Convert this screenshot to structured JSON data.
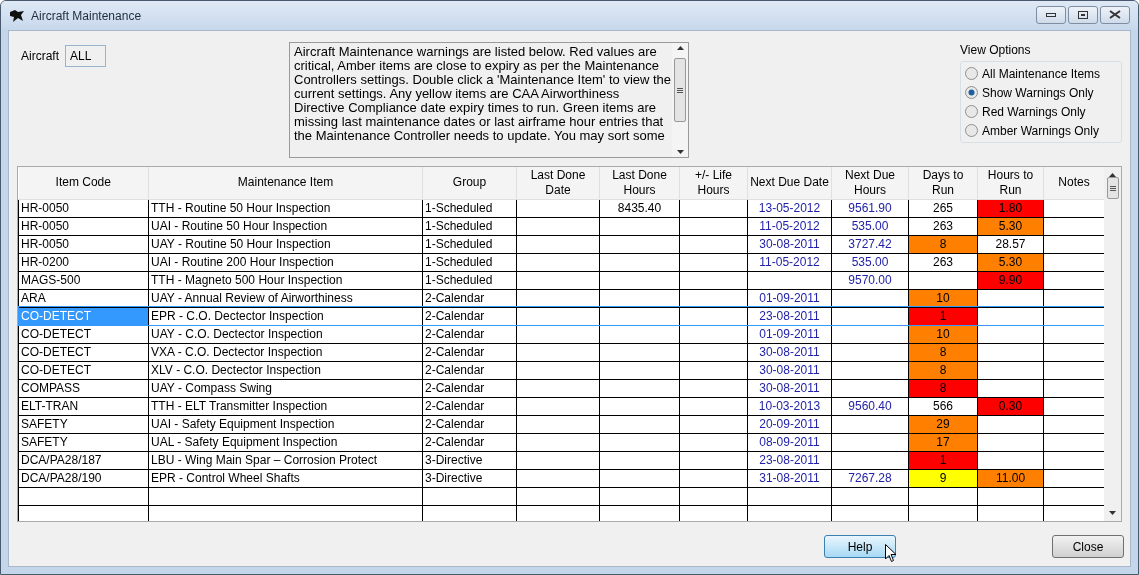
{
  "window": {
    "title": "Aircraft Maintenance"
  },
  "aircraft": {
    "label": "Aircraft",
    "value": "ALL"
  },
  "description": "Aircraft Maintenance warnings are listed below. Red values are critical, Amber items are close to expiry as per the Maintenance Controllers settings. Double click a 'Maintenance Item' to view the current settings. Any yellow items are CAA Airworthiness Directive Compliance date expiry times to run. Green items are missing last maintenance dates or last airframe hour entries that the Maintenance Controller needs to update. You may sort some",
  "view_options": {
    "title": "View Options",
    "options": [
      {
        "label": "All Maintenance Items",
        "selected": false
      },
      {
        "label": "Show Warnings Only",
        "selected": true
      },
      {
        "label": "Red Warnings Only",
        "selected": false
      },
      {
        "label": "Amber Warnings Only",
        "selected": false
      }
    ]
  },
  "table": {
    "columns": [
      "Item Code",
      "Maintenance Item",
      "Group",
      "Last Done Date",
      "Last Done Hours",
      "+/- Life Hours",
      "Next Due Date",
      "Next Due Hours",
      "Days to Run",
      "Hours to Run",
      "Notes"
    ],
    "rows": [
      {
        "item_code": "HR-0050",
        "maintenance_item": "TTH - Routine 50 Hour Inspection",
        "group": "1-Scheduled",
        "last_done_hours": "8435.40",
        "next_due_date": "13-05-2012",
        "next_due_hours": "9561.90",
        "days_to_run": {
          "text": "265"
        },
        "hours_to_run": {
          "text": "1.80",
          "color": "#ff0000"
        },
        "selected": false
      },
      {
        "item_code": "HR-0050",
        "maintenance_item": "UAI - Routine 50 Hour Inspection",
        "group": "1-Scheduled",
        "next_due_date": "11-05-2012",
        "next_due_hours": "535.00",
        "days_to_run": {
          "text": "263"
        },
        "hours_to_run": {
          "text": "5.30",
          "color": "#ff8000"
        },
        "selected": false
      },
      {
        "item_code": "HR-0050",
        "maintenance_item": "UAY - Routine 50 Hour Inspection",
        "group": "1-Scheduled",
        "next_due_date": "30-08-2011",
        "next_due_hours": "3727.42",
        "days_to_run": {
          "text": "8",
          "color": "#ff8000"
        },
        "hours_to_run": {
          "text": "28.57"
        },
        "selected": false
      },
      {
        "item_code": "HR-0200",
        "maintenance_item": "UAI - Routine 200 Hour Inspection",
        "group": "1-Scheduled",
        "next_due_date": "11-05-2012",
        "next_due_hours": "535.00",
        "days_to_run": {
          "text": "263"
        },
        "hours_to_run": {
          "text": "5.30",
          "color": "#ff8000"
        },
        "selected": false
      },
      {
        "item_code": "MAGS-500",
        "maintenance_item": "TTH - Magneto 500 Hour Inspection",
        "group": "1-Scheduled",
        "next_due_hours": "9570.00",
        "hours_to_run": {
          "text": "9.90",
          "color": "#ff0000"
        },
        "selected": false
      },
      {
        "item_code": "ARA",
        "maintenance_item": "UAY - Annual Review of Airworthiness",
        "group": "2-Calendar",
        "next_due_date": "01-09-2011",
        "days_to_run": {
          "text": "10",
          "color": "#ff8000"
        },
        "selected": false
      },
      {
        "item_code": "CO-DETECT",
        "maintenance_item": "EPR - C.O. Dectector Inspection",
        "group": "2-Calendar",
        "next_due_date": "23-08-2011",
        "days_to_run": {
          "text": "1",
          "color": "#ff0000"
        },
        "selected": true
      },
      {
        "item_code": "CO-DETECT",
        "maintenance_item": "UAY - C.O. Dectector Inspection",
        "group": "2-Calendar",
        "next_due_date": "01-09-2011",
        "days_to_run": {
          "text": "10",
          "color": "#ff8000"
        },
        "selected": false
      },
      {
        "item_code": "CO-DETECT",
        "maintenance_item": "VXA - C.O. Dectector Inspection",
        "group": "2-Calendar",
        "next_due_date": "30-08-2011",
        "days_to_run": {
          "text": "8",
          "color": "#ff8000"
        },
        "selected": false
      },
      {
        "item_code": "CO-DETECT",
        "maintenance_item": "XLV - C.O. Dectector Inspection",
        "group": "2-Calendar",
        "next_due_date": "30-08-2011",
        "days_to_run": {
          "text": "8",
          "color": "#ff8000"
        },
        "selected": false
      },
      {
        "item_code": "COMPASS",
        "maintenance_item": "UAY - Compass Swing",
        "group": "2-Calendar",
        "next_due_date": "30-08-2011",
        "days_to_run": {
          "text": "8",
          "color": "#ff0000"
        },
        "selected": false
      },
      {
        "item_code": "ELT-TRAN",
        "maintenance_item": "TTH - ELT Transmitter Inspection",
        "group": "2-Calendar",
        "next_due_date": "10-03-2013",
        "next_due_hours": "9560.40",
        "days_to_run": {
          "text": "566"
        },
        "hours_to_run": {
          "text": "0.30",
          "color": "#ff0000"
        },
        "selected": false
      },
      {
        "item_code": "SAFETY",
        "maintenance_item": "UAI - Safety Equipment Inspection",
        "group": "2-Calendar",
        "next_due_date": "20-09-2011",
        "days_to_run": {
          "text": "29",
          "color": "#ff8000"
        },
        "selected": false
      },
      {
        "item_code": "SAFETY",
        "maintenance_item": "UAL - Safety Equipment Inspection",
        "group": "2-Calendar",
        "next_due_date": "08-09-2011",
        "days_to_run": {
          "text": "17",
          "color": "#ff8000"
        },
        "selected": false
      },
      {
        "item_code": "DCA/PA28/187",
        "maintenance_item": "LBU - Wing Main Spar – Corrosion Protect",
        "group": "3-Directive",
        "next_due_date": "23-08-2011",
        "days_to_run": {
          "text": "1",
          "color": "#ff0000"
        },
        "selected": false
      },
      {
        "item_code": "DCA/PA28/190",
        "maintenance_item": "EPR - Control Wheel Shafts",
        "group": "3-Directive",
        "next_due_date": "31-08-2011",
        "next_due_hours": "7267.28",
        "days_to_run": {
          "text": "9",
          "color": "#ffff00"
        },
        "hours_to_run": {
          "text": "11.00",
          "color": "#ff8000"
        },
        "selected": false
      }
    ]
  },
  "buttons": [
    {
      "label": "Help",
      "hovered": true
    },
    {
      "label": "Close",
      "hovered": false
    }
  ]
}
